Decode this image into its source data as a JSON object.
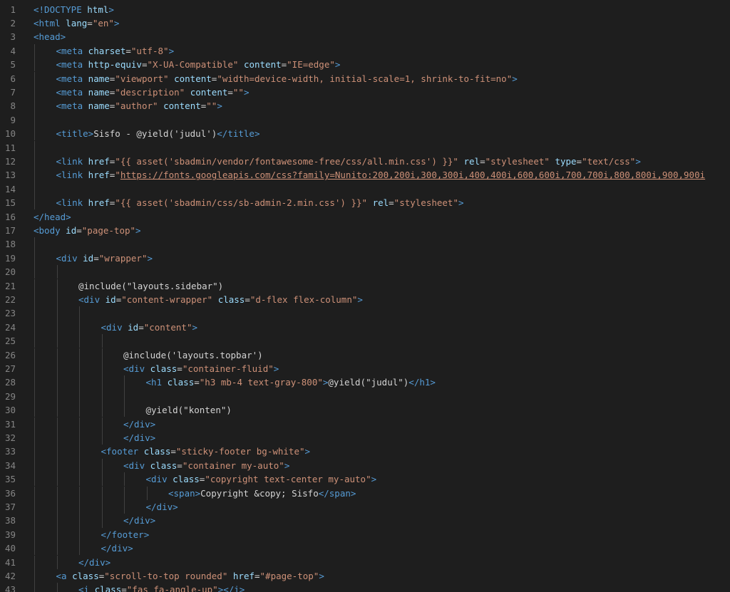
{
  "editor": {
    "theme": {
      "background": "#1e1e1e",
      "line_number": "#858585",
      "tag": "#569cd6",
      "attribute": "#9cdcfe",
      "string": "#ce9178",
      "text": "#d4d4d4"
    },
    "lines": [
      {
        "number": "1",
        "indent": 0,
        "tokens": [
          [
            "t-tag",
            "<!DOCTYPE"
          ],
          [
            "t-text",
            " "
          ],
          [
            "t-attr",
            "html"
          ],
          [
            "t-tag",
            ">"
          ]
        ]
      },
      {
        "number": "2",
        "indent": 0,
        "tokens": [
          [
            "t-tag",
            "<html"
          ],
          [
            "t-text",
            " "
          ],
          [
            "t-attr",
            "lang"
          ],
          [
            "t-text",
            "="
          ],
          [
            "t-str",
            "\"en\""
          ],
          [
            "t-tag",
            ">"
          ]
        ]
      },
      {
        "number": "3",
        "indent": 0,
        "tokens": [
          [
            "t-tag",
            "<head>"
          ]
        ]
      },
      {
        "number": "4",
        "indent": 1,
        "tokens": [
          [
            "t-tag",
            "<meta"
          ],
          [
            "t-text",
            " "
          ],
          [
            "t-attr",
            "charset"
          ],
          [
            "t-text",
            "="
          ],
          [
            "t-str",
            "\"utf-8\""
          ],
          [
            "t-tag",
            ">"
          ]
        ]
      },
      {
        "number": "5",
        "indent": 1,
        "tokens": [
          [
            "t-tag",
            "<meta"
          ],
          [
            "t-text",
            " "
          ],
          [
            "t-attr",
            "http-equiv"
          ],
          [
            "t-text",
            "="
          ],
          [
            "t-str",
            "\"X-UA-Compatible\""
          ],
          [
            "t-text",
            " "
          ],
          [
            "t-attr",
            "content"
          ],
          [
            "t-text",
            "="
          ],
          [
            "t-str",
            "\"IE=edge\""
          ],
          [
            "t-tag",
            ">"
          ]
        ]
      },
      {
        "number": "6",
        "indent": 1,
        "tokens": [
          [
            "t-tag",
            "<meta"
          ],
          [
            "t-text",
            " "
          ],
          [
            "t-attr",
            "name"
          ],
          [
            "t-text",
            "="
          ],
          [
            "t-str",
            "\"viewport\""
          ],
          [
            "t-text",
            " "
          ],
          [
            "t-attr",
            "content"
          ],
          [
            "t-text",
            "="
          ],
          [
            "t-str",
            "\"width=device-width, initial-scale=1, shrink-to-fit=no\""
          ],
          [
            "t-tag",
            ">"
          ]
        ]
      },
      {
        "number": "7",
        "indent": 1,
        "tokens": [
          [
            "t-tag",
            "<meta"
          ],
          [
            "t-text",
            " "
          ],
          [
            "t-attr",
            "name"
          ],
          [
            "t-text",
            "="
          ],
          [
            "t-str",
            "\"description\""
          ],
          [
            "t-text",
            " "
          ],
          [
            "t-attr",
            "content"
          ],
          [
            "t-text",
            "="
          ],
          [
            "t-str",
            "\"\""
          ],
          [
            "t-tag",
            ">"
          ]
        ]
      },
      {
        "number": "8",
        "indent": 1,
        "tokens": [
          [
            "t-tag",
            "<meta"
          ],
          [
            "t-text",
            " "
          ],
          [
            "t-attr",
            "name"
          ],
          [
            "t-text",
            "="
          ],
          [
            "t-str",
            "\"author\""
          ],
          [
            "t-text",
            " "
          ],
          [
            "t-attr",
            "content"
          ],
          [
            "t-text",
            "="
          ],
          [
            "t-str",
            "\"\""
          ],
          [
            "t-tag",
            ">"
          ]
        ]
      },
      {
        "number": "9",
        "indent": 1,
        "tokens": []
      },
      {
        "number": "10",
        "indent": 1,
        "tokens": [
          [
            "t-tag",
            "<title>"
          ],
          [
            "t-text",
            "Sisfo - @yield('judul')"
          ],
          [
            "t-tag",
            "</title>"
          ]
        ]
      },
      {
        "number": "11",
        "indent": 1,
        "tokens": []
      },
      {
        "number": "12",
        "indent": 1,
        "tokens": [
          [
            "t-tag",
            "<link"
          ],
          [
            "t-text",
            " "
          ],
          [
            "t-attr",
            "href"
          ],
          [
            "t-text",
            "="
          ],
          [
            "t-str",
            "\"{{ asset('sbadmin/vendor/fontawesome-free/css/all.min.css') }}\""
          ],
          [
            "t-text",
            " "
          ],
          [
            "t-attr",
            "rel"
          ],
          [
            "t-text",
            "="
          ],
          [
            "t-str",
            "\"stylesheet\""
          ],
          [
            "t-text",
            " "
          ],
          [
            "t-attr",
            "type"
          ],
          [
            "t-text",
            "="
          ],
          [
            "t-str",
            "\"text/css\""
          ],
          [
            "t-tag",
            ">"
          ]
        ]
      },
      {
        "number": "13",
        "indent": 1,
        "tokens": [
          [
            "t-tag",
            "<link"
          ],
          [
            "t-text",
            " "
          ],
          [
            "t-attr",
            "href"
          ],
          [
            "t-text",
            "="
          ],
          [
            "t-str",
            "\""
          ],
          [
            "t-link",
            "https://fonts.googleapis.com/css?family=Nunito:200,200i,300,300i,400,400i,600,600i,700,700i,800,800i,900,900i"
          ]
        ]
      },
      {
        "number": "14",
        "indent": 1,
        "tokens": []
      },
      {
        "number": "15",
        "indent": 1,
        "tokens": [
          [
            "t-tag",
            "<link"
          ],
          [
            "t-text",
            " "
          ],
          [
            "t-attr",
            "href"
          ],
          [
            "t-text",
            "="
          ],
          [
            "t-str",
            "\"{{ asset('sbadmin/css/sb-admin-2.min.css') }}\""
          ],
          [
            "t-text",
            " "
          ],
          [
            "t-attr",
            "rel"
          ],
          [
            "t-text",
            "="
          ],
          [
            "t-str",
            "\"stylesheet\""
          ],
          [
            "t-tag",
            ">"
          ]
        ]
      },
      {
        "number": "16",
        "indent": 0,
        "tokens": [
          [
            "t-tag",
            "</head>"
          ]
        ]
      },
      {
        "number": "17",
        "indent": 0,
        "tokens": [
          [
            "t-tag",
            "<body"
          ],
          [
            "t-text",
            " "
          ],
          [
            "t-attr",
            "id"
          ],
          [
            "t-text",
            "="
          ],
          [
            "t-str",
            "\"page-top\""
          ],
          [
            "t-tag",
            ">"
          ]
        ]
      },
      {
        "number": "18",
        "indent": 1,
        "tokens": []
      },
      {
        "number": "19",
        "indent": 1,
        "tokens": [
          [
            "t-tag",
            "<div"
          ],
          [
            "t-text",
            " "
          ],
          [
            "t-attr",
            "id"
          ],
          [
            "t-text",
            "="
          ],
          [
            "t-str",
            "\"wrapper\""
          ],
          [
            "t-tag",
            ">"
          ]
        ]
      },
      {
        "number": "20",
        "indent": 2,
        "tokens": []
      },
      {
        "number": "21",
        "indent": 2,
        "tokens": [
          [
            "t-text",
            "@include(\"layouts.sidebar\")"
          ]
        ]
      },
      {
        "number": "22",
        "indent": 2,
        "tokens": [
          [
            "t-tag",
            "<div"
          ],
          [
            "t-text",
            " "
          ],
          [
            "t-attr",
            "id"
          ],
          [
            "t-text",
            "="
          ],
          [
            "t-str",
            "\"content-wrapper\""
          ],
          [
            "t-text",
            " "
          ],
          [
            "t-attr",
            "class"
          ],
          [
            "t-text",
            "="
          ],
          [
            "t-str",
            "\"d-flex flex-column\""
          ],
          [
            "t-tag",
            ">"
          ]
        ]
      },
      {
        "number": "23",
        "indent": 3,
        "tokens": []
      },
      {
        "number": "24",
        "indent": 3,
        "tokens": [
          [
            "t-tag",
            "<div"
          ],
          [
            "t-text",
            " "
          ],
          [
            "t-attr",
            "id"
          ],
          [
            "t-text",
            "="
          ],
          [
            "t-str",
            "\"content\""
          ],
          [
            "t-tag",
            ">"
          ]
        ]
      },
      {
        "number": "25",
        "indent": 4,
        "tokens": []
      },
      {
        "number": "26",
        "indent": 4,
        "tokens": [
          [
            "t-text",
            "@include('layouts.topbar')"
          ]
        ]
      },
      {
        "number": "27",
        "indent": 4,
        "tokens": [
          [
            "t-tag",
            "<div"
          ],
          [
            "t-text",
            " "
          ],
          [
            "t-attr",
            "class"
          ],
          [
            "t-text",
            "="
          ],
          [
            "t-str",
            "\"container-fluid\""
          ],
          [
            "t-tag",
            ">"
          ]
        ]
      },
      {
        "number": "28",
        "indent": 5,
        "tokens": [
          [
            "t-tag",
            "<h1"
          ],
          [
            "t-text",
            " "
          ],
          [
            "t-attr",
            "class"
          ],
          [
            "t-text",
            "="
          ],
          [
            "t-str",
            "\"h3 mb-4 text-gray-800\""
          ],
          [
            "t-tag",
            ">"
          ],
          [
            "t-text",
            "@yield(\"judul\")"
          ],
          [
            "t-tag",
            "</h1>"
          ]
        ]
      },
      {
        "number": "29",
        "indent": 5,
        "tokens": []
      },
      {
        "number": "30",
        "indent": 5,
        "tokens": [
          [
            "t-text",
            "@yield(\"konten\")"
          ]
        ]
      },
      {
        "number": "31",
        "indent": 4,
        "tokens": [
          [
            "t-tag",
            "</div>"
          ]
        ]
      },
      {
        "number": "32",
        "indent": 4,
        "tokens": [
          [
            "t-tag",
            "</div>"
          ]
        ]
      },
      {
        "number": "33",
        "indent": 3,
        "tokens": [
          [
            "t-tag",
            "<footer"
          ],
          [
            "t-text",
            " "
          ],
          [
            "t-attr",
            "class"
          ],
          [
            "t-text",
            "="
          ],
          [
            "t-str",
            "\"sticky-footer bg-white\""
          ],
          [
            "t-tag",
            ">"
          ]
        ]
      },
      {
        "number": "34",
        "indent": 4,
        "tokens": [
          [
            "t-tag",
            "<div"
          ],
          [
            "t-text",
            " "
          ],
          [
            "t-attr",
            "class"
          ],
          [
            "t-text",
            "="
          ],
          [
            "t-str",
            "\"container my-auto\""
          ],
          [
            "t-tag",
            ">"
          ]
        ]
      },
      {
        "number": "35",
        "indent": 5,
        "tokens": [
          [
            "t-tag",
            "<div"
          ],
          [
            "t-text",
            " "
          ],
          [
            "t-attr",
            "class"
          ],
          [
            "t-text",
            "="
          ],
          [
            "t-str",
            "\"copyright text-center my-auto\""
          ],
          [
            "t-tag",
            ">"
          ]
        ]
      },
      {
        "number": "36",
        "indent": 6,
        "tokens": [
          [
            "t-tag",
            "<span>"
          ],
          [
            "t-text",
            "Copyright &copy; Sisfo"
          ],
          [
            "t-tag",
            "</span>"
          ]
        ]
      },
      {
        "number": "37",
        "indent": 5,
        "tokens": [
          [
            "t-tag",
            "</div>"
          ]
        ]
      },
      {
        "number": "38",
        "indent": 4,
        "tokens": [
          [
            "t-tag",
            "</div>"
          ]
        ]
      },
      {
        "number": "39",
        "indent": 3,
        "tokens": [
          [
            "t-tag",
            "</footer>"
          ]
        ]
      },
      {
        "number": "40",
        "indent": 3,
        "tokens": [
          [
            "t-tag",
            "</div>"
          ]
        ]
      },
      {
        "number": "41",
        "indent": 2,
        "tokens": [
          [
            "t-tag",
            "</div>"
          ]
        ]
      },
      {
        "number": "42",
        "indent": 1,
        "tokens": [
          [
            "t-tag",
            "<a"
          ],
          [
            "t-text",
            " "
          ],
          [
            "t-attr",
            "class"
          ],
          [
            "t-text",
            "="
          ],
          [
            "t-str",
            "\"scroll-to-top rounded\""
          ],
          [
            "t-text",
            " "
          ],
          [
            "t-attr",
            "href"
          ],
          [
            "t-text",
            "="
          ],
          [
            "t-str",
            "\"#page-top\""
          ],
          [
            "t-tag",
            ">"
          ]
        ]
      },
      {
        "number": "43",
        "indent": 2,
        "tokens": [
          [
            "t-tag",
            "<i"
          ],
          [
            "t-text",
            " "
          ],
          [
            "t-attr",
            "class"
          ],
          [
            "t-text",
            "="
          ],
          [
            "t-str",
            "\"fas fa-angle-up\""
          ],
          [
            "t-tag",
            ">"
          ],
          [
            "t-tag",
            "</i>"
          ]
        ]
      }
    ]
  }
}
